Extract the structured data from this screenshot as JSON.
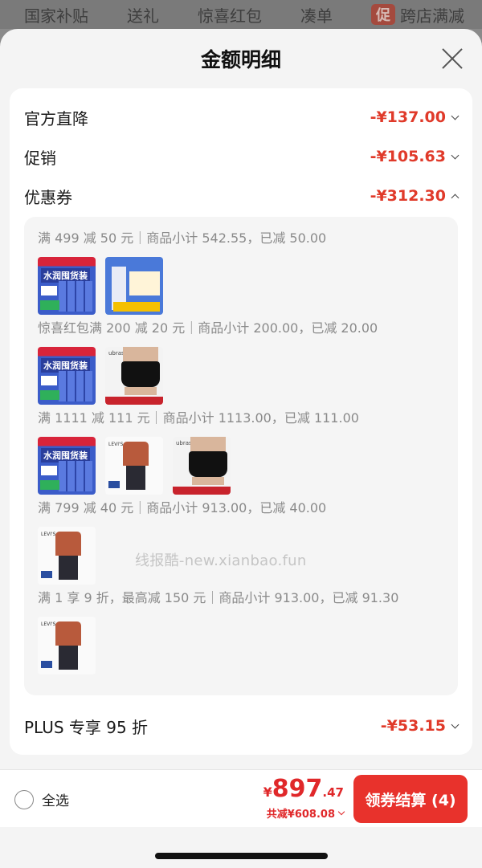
{
  "top_tabs": [
    "国家补贴",
    "送礼",
    "惊喜红包",
    "凑单",
    "跨店满减"
  ],
  "promo_badge": "促",
  "sheet": {
    "title": "金额明细"
  },
  "summary_rows": [
    {
      "label": "官方直降",
      "amount": "-¥137.00"
    },
    {
      "label": "促销",
      "amount": "-¥105.63"
    },
    {
      "label": "优惠券",
      "amount": "-¥312.30"
    }
  ],
  "coupon_groups": [
    {
      "text": "满 499 减 50 元｜商品小计 542.55，已减 50.00",
      "products": [
        "water-pack",
        "blue-box"
      ]
    },
    {
      "text": "惊喜红包满 200 减 20 元｜商品小计 200.00，已减 20.00",
      "products": [
        "water-pack",
        "shorts"
      ]
    },
    {
      "text": "满 1111 减 111 元｜商品小计 1113.00，已减 111.00",
      "products": [
        "water-pack",
        "jacket",
        "shorts"
      ]
    },
    {
      "text": "满 799 减 40 元｜商品小计 913.00，已减 40.00",
      "products": [
        "jacket"
      ]
    },
    {
      "text": "满 1 享 9 折，最高减 150 元｜商品小计 913.00，已减 91.30",
      "products": [
        "jacket"
      ]
    }
  ],
  "plus_row": {
    "label": "PLUS 专享 95 折",
    "amount": "-¥53.15"
  },
  "watermark": "线报酷-new.xianbao.fun",
  "bottom": {
    "select_all": "全选",
    "currency": "¥",
    "total_int": "897",
    "total_dec": ".47",
    "saved": "共减¥608.08",
    "checkout": "领券结算 (4)"
  },
  "colors": {
    "accent": "#e8322c",
    "discount": "#e03a2a"
  }
}
